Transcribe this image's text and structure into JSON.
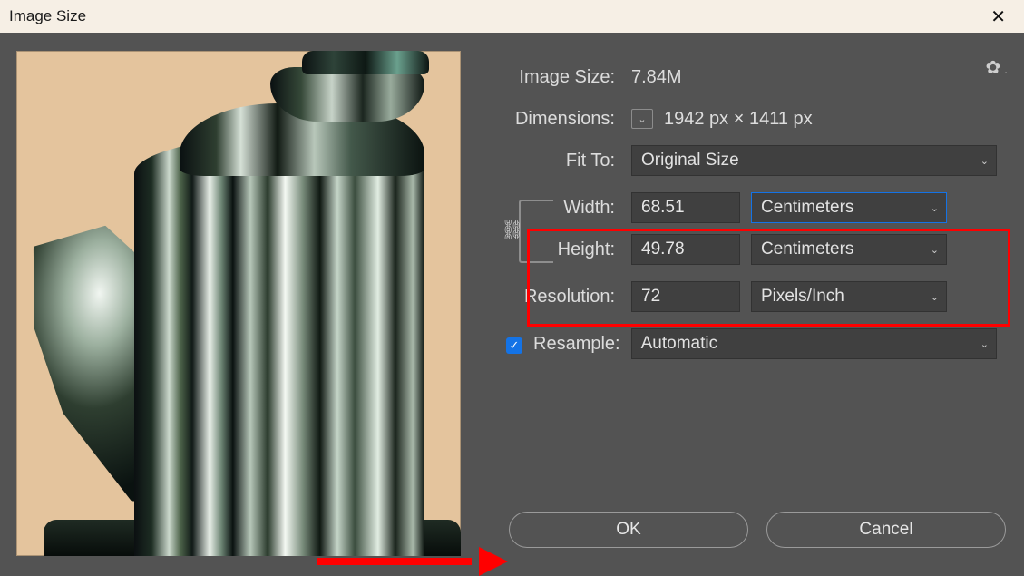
{
  "title": "Image Size",
  "image_size": {
    "label": "Image Size:",
    "value": "7.84M"
  },
  "dimensions": {
    "label": "Dimensions:",
    "value": "1942 px  ×  1411 px"
  },
  "fit_to": {
    "label": "Fit To:",
    "value": "Original Size"
  },
  "width": {
    "label": "Width:",
    "value": "68.51",
    "unit": "Centimeters"
  },
  "height": {
    "label": "Height:",
    "value": "49.78",
    "unit": "Centimeters"
  },
  "resolution": {
    "label": "Resolution:",
    "value": "72",
    "unit": "Pixels/Inch"
  },
  "resample": {
    "label": "Resample:",
    "checked": true,
    "value": "Automatic"
  },
  "buttons": {
    "ok": "OK",
    "cancel": "Cancel"
  }
}
